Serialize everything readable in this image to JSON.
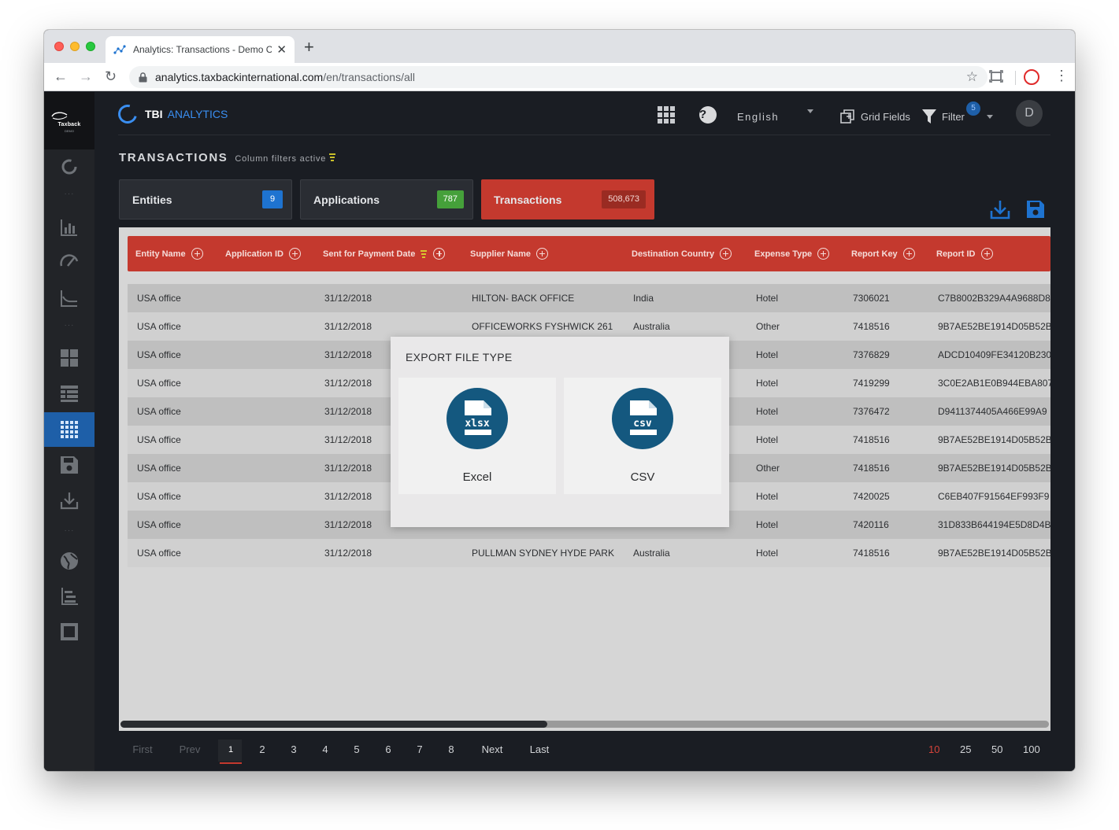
{
  "browser": {
    "tab_title": "Analytics: Transactions - Demo C",
    "url_host": "analytics.taxbackinternational.com",
    "url_path": "/en/transactions/all"
  },
  "sidebar": {
    "logo_text": "Taxback",
    "logo_sub": "DEMO",
    "items": [
      {
        "icon": "loading-circle-icon"
      },
      {
        "icon": "bar-chart-icon"
      },
      {
        "icon": "gauge-icon"
      },
      {
        "icon": "line-chart-icon"
      },
      {
        "icon": "dashboard-tiles-icon"
      },
      {
        "icon": "list-view-icon"
      },
      {
        "icon": "grid-view-icon",
        "active": true
      },
      {
        "icon": "save-icon"
      },
      {
        "icon": "download-icon"
      },
      {
        "icon": "globe-icon"
      },
      {
        "icon": "hierarchy-list-icon"
      },
      {
        "icon": "frame-icon"
      }
    ]
  },
  "header": {
    "brand_tbi": "TBI",
    "brand_analytics": "ANALYTICS",
    "language": "English",
    "grid_fields": "Grid Fields",
    "filter": "Filter",
    "filter_count": "5",
    "avatar_initial": "D"
  },
  "page": {
    "title": "TRANSACTIONS",
    "subtitle": "Column filters active"
  },
  "cards": {
    "entities": {
      "label": "Entities",
      "count": "9"
    },
    "applications": {
      "label": "Applications",
      "count": "787"
    },
    "transactions": {
      "label": "Transactions",
      "count": "508,673"
    }
  },
  "grid": {
    "columns": [
      "Entity Name",
      "Application ID",
      "Sent for Payment Date",
      "Supplier Name",
      "Destination Country",
      "Expense Type",
      "Report Key",
      "Report ID"
    ],
    "rows": [
      [
        "USA office",
        "",
        "31/12/2018",
        "HILTON- BACK OFFICE",
        "India",
        "Hotel",
        "7306021",
        "C7B8002B329A4A9688D8"
      ],
      [
        "USA office",
        "",
        "31/12/2018",
        "OFFICEWORKS FYSHWICK 261",
        "Australia",
        "Other",
        "7418516",
        "9B7AE52BE1914D05B52B"
      ],
      [
        "USA office",
        "",
        "31/12/2018",
        "",
        "",
        "Hotel",
        "7376829",
        "ADCD10409FE34120B230"
      ],
      [
        "USA office",
        "",
        "31/12/2018",
        "",
        "",
        "Hotel",
        "7419299",
        "3C0E2AB1E0B944EBA807"
      ],
      [
        "USA office",
        "",
        "31/12/2018",
        "",
        "",
        "Hotel",
        "7376472",
        "D9411374405A466E99A9"
      ],
      [
        "USA office",
        "",
        "31/12/2018",
        "",
        "",
        "Hotel",
        "7418516",
        "9B7AE52BE1914D05B52B"
      ],
      [
        "USA office",
        "",
        "31/12/2018",
        "",
        "",
        "Other",
        "7418516",
        "9B7AE52BE1914D05B52B"
      ],
      [
        "USA office",
        "",
        "31/12/2018",
        "",
        "",
        "Hotel",
        "7420025",
        "C6EB407F91564EF993F9"
      ],
      [
        "USA office",
        "",
        "31/12/2018",
        "",
        "",
        "Hotel",
        "7420116",
        "31D833B644194E5D8D4B"
      ],
      [
        "USA office",
        "",
        "31/12/2018",
        "PULLMAN SYDNEY HYDE PARK",
        "Australia",
        "Hotel",
        "7418516",
        "9B7AE52BE1914D05B52B"
      ]
    ]
  },
  "pager": {
    "first": "First",
    "prev": "Prev",
    "pages": [
      "1",
      "2",
      "3",
      "4",
      "5",
      "6",
      "7",
      "8"
    ],
    "current_page": "1",
    "next": "Next",
    "last": "Last",
    "sizes": [
      "10",
      "25",
      "50",
      "100"
    ],
    "active_size": "10"
  },
  "modal": {
    "title": "EXPORT FILE TYPE",
    "options": [
      {
        "label": "Excel",
        "file_tag": "xlsx"
      },
      {
        "label": "CSV",
        "file_tag": "csv"
      }
    ]
  },
  "colors": {
    "accent_red": "#c4392e",
    "accent_blue": "#1e73d0",
    "accent_green": "#45a03a",
    "modal_icon": "#14587f"
  }
}
